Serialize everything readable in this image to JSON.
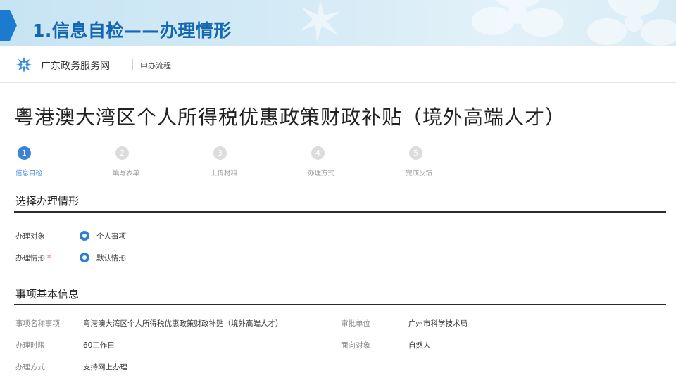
{
  "slide": {
    "title": "1.信息自检——办理情形",
    "accent_color": "#1a7bd0"
  },
  "site": {
    "logo_icon": "guangdong-gov-logo-icon",
    "name": "广东政务服务网",
    "breadcrumb": "申办流程"
  },
  "page": {
    "title": "粤港澳大湾区个人所得税优惠政策财政补贴（境外高端人才）"
  },
  "steps": [
    {
      "num": "1",
      "label": "信息自检",
      "active": true
    },
    {
      "num": "2",
      "label": "填写表单",
      "active": false
    },
    {
      "num": "3",
      "label": "上传材料",
      "active": false
    },
    {
      "num": "4",
      "label": "办理方式",
      "active": false
    },
    {
      "num": "5",
      "label": "完成反馈",
      "active": false
    }
  ],
  "situation": {
    "heading": "选择办理情形",
    "target_label": "办理对象",
    "target_value": "个人事项",
    "case_label": "办理情形",
    "required_mark": "*",
    "case_value": "默认情形"
  },
  "basic_info": {
    "heading": "事项基本信息",
    "name_label": "事项名称事项",
    "name_value": "粤港澳大湾区个人所得税优惠政策财政补贴（境外高端人才）",
    "approver_label": "审批单位",
    "approver_value": "广州市科学技术局",
    "deadline_label": "办理时限",
    "deadline_value": "60工作日",
    "audience_label": "面向对象",
    "audience_value": "自然人",
    "method_label": "办理方式",
    "method_value": "支持网上办理"
  },
  "colors": {
    "primary": "#3a84d6",
    "title_blue": "#1567b0",
    "required": "#d33333"
  }
}
